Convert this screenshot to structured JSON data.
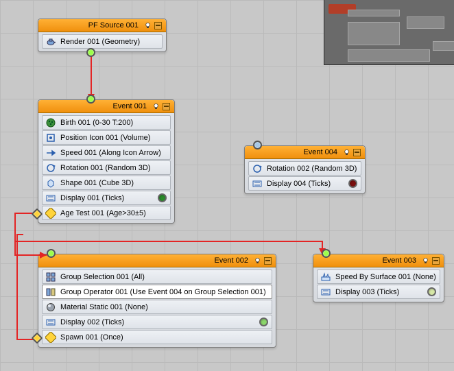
{
  "preview": {
    "name": "navigator-preview"
  },
  "pf_source": {
    "title": "PF Source 001",
    "row_render": "Render 001 (Geometry)",
    "icon_render": "teapot-icon"
  },
  "event1": {
    "title": "Event 001",
    "rows": {
      "birth": "Birth 001 (0-30 T:200)",
      "position": "Position Icon 001 (Volume)",
      "speed": "Speed 001 (Along Icon Arrow)",
      "rotation": "Rotation 001 (Random 3D)",
      "shape": "Shape 001 (Cube 3D)",
      "display": "Display 001 (Ticks)",
      "agetest": "Age Test 001 (Age>30±5)"
    },
    "display_dot_color": "#2a8a2a"
  },
  "event2": {
    "title": "Event 002",
    "rows": {
      "groupsel": "Group Selection 001 (All)",
      "groupop": "Group Operator 001 (Use Event 004 on Group Selection 001)",
      "material": "Material Static 001 (None)",
      "display": "Display 002 (Ticks)",
      "spawn": "Spawn 001 (Once)"
    },
    "display_dot_color": "#8bd66b"
  },
  "event3": {
    "title": "Event 003",
    "rows": {
      "sbs": "Speed By Surface 001 (None)",
      "display": "Display 003 (Ticks)"
    },
    "display_dot_color": "#d6e8a6"
  },
  "event4": {
    "title": "Event 004",
    "rows": {
      "rotation": "Rotation 002 (Random 3D)",
      "display": "Display 004 (Ticks)"
    },
    "display_dot_color": "#7a0f0f"
  },
  "colors": {
    "title_bg": "#f79a1c",
    "green_port": "#8fe23a",
    "blue_port": "#a7c8e6",
    "wire_red": "#e32424"
  }
}
